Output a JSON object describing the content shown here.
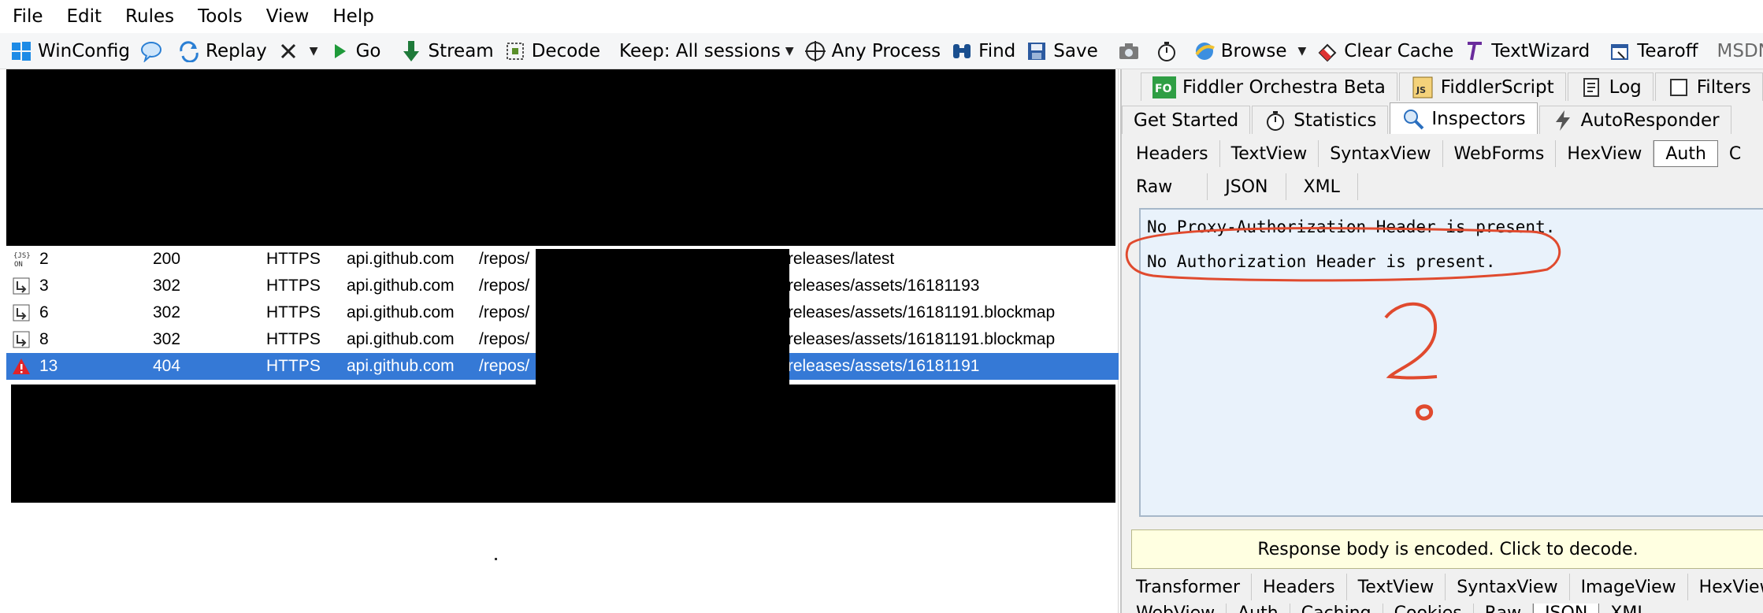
{
  "menu": [
    "File",
    "Edit",
    "Rules",
    "Tools",
    "View",
    "Help"
  ],
  "toolbar": {
    "winconfig": "WinConfig",
    "replay": "Replay",
    "go": "Go",
    "stream": "Stream",
    "decode": "Decode",
    "keep": "Keep: All sessions",
    "any_process": "Any Process",
    "find": "Find",
    "save": "Save",
    "browse": "Browse",
    "clear_cache": "Clear Cache",
    "textwizard": "TextWizard",
    "tearoff": "Tearoff",
    "msdn": "MSDN Se"
  },
  "sessions": [
    {
      "id": "2",
      "result": "200",
      "protocol": "HTTPS",
      "host": "api.github.com",
      "url_start": "/repos/",
      "url_end": "/releases/latest",
      "icon": "json-icon",
      "selected": false
    },
    {
      "id": "3",
      "result": "302",
      "protocol": "HTTPS",
      "host": "api.github.com",
      "url_start": "/repos/",
      "url_end": "/releases/assets/16181193",
      "icon": "redirect-icon",
      "selected": false
    },
    {
      "id": "6",
      "result": "302",
      "protocol": "HTTPS",
      "host": "api.github.com",
      "url_start": "/repos/",
      "url_end": "/releases/assets/16181191.blockmap",
      "icon": "redirect-icon",
      "selected": false
    },
    {
      "id": "8",
      "result": "302",
      "protocol": "HTTPS",
      "host": "api.github.com",
      "url_start": "/repos/",
      "url_end": "/releases/assets/16181191.blockmap",
      "icon": "redirect-icon",
      "selected": false
    },
    {
      "id": "13",
      "result": "404",
      "protocol": "HTTPS",
      "host": "api.github.com",
      "url_start": "/repos/",
      "url_end": "/releases/assets/16181191",
      "icon": "error-icon",
      "selected": true
    }
  ],
  "right": {
    "tabs_row1": [
      "Fiddler Orchestra Beta",
      "FiddlerScript",
      "Log",
      "Filters"
    ],
    "tabs_row2": [
      "Get Started",
      "Statistics",
      "Inspectors",
      "AutoResponder"
    ],
    "request_tabs": [
      "Headers",
      "TextView",
      "SyntaxView",
      "WebForms",
      "HexView",
      "Auth",
      "C"
    ],
    "request_tabs2": [
      "Raw",
      "JSON",
      "XML"
    ],
    "auth_lines": [
      "No Proxy-Authorization Header is present.",
      "No Authorization Header is present."
    ],
    "annotation_mark": "?",
    "encoded_notice": "Response body is encoded. Click to decode.",
    "response_tabs": [
      "Transformer",
      "Headers",
      "TextView",
      "SyntaxView",
      "ImageView",
      "HexView"
    ],
    "response_tabs2": [
      "WebView",
      "Auth",
      "Caching",
      "Cookies",
      "Raw",
      "JSON",
      "XML"
    ]
  },
  "colors": {
    "selection": "#3579d6",
    "annotation": "#e04a2e",
    "auth_bg": "#e9f2fb",
    "notice_bg": "#ffffe1"
  }
}
